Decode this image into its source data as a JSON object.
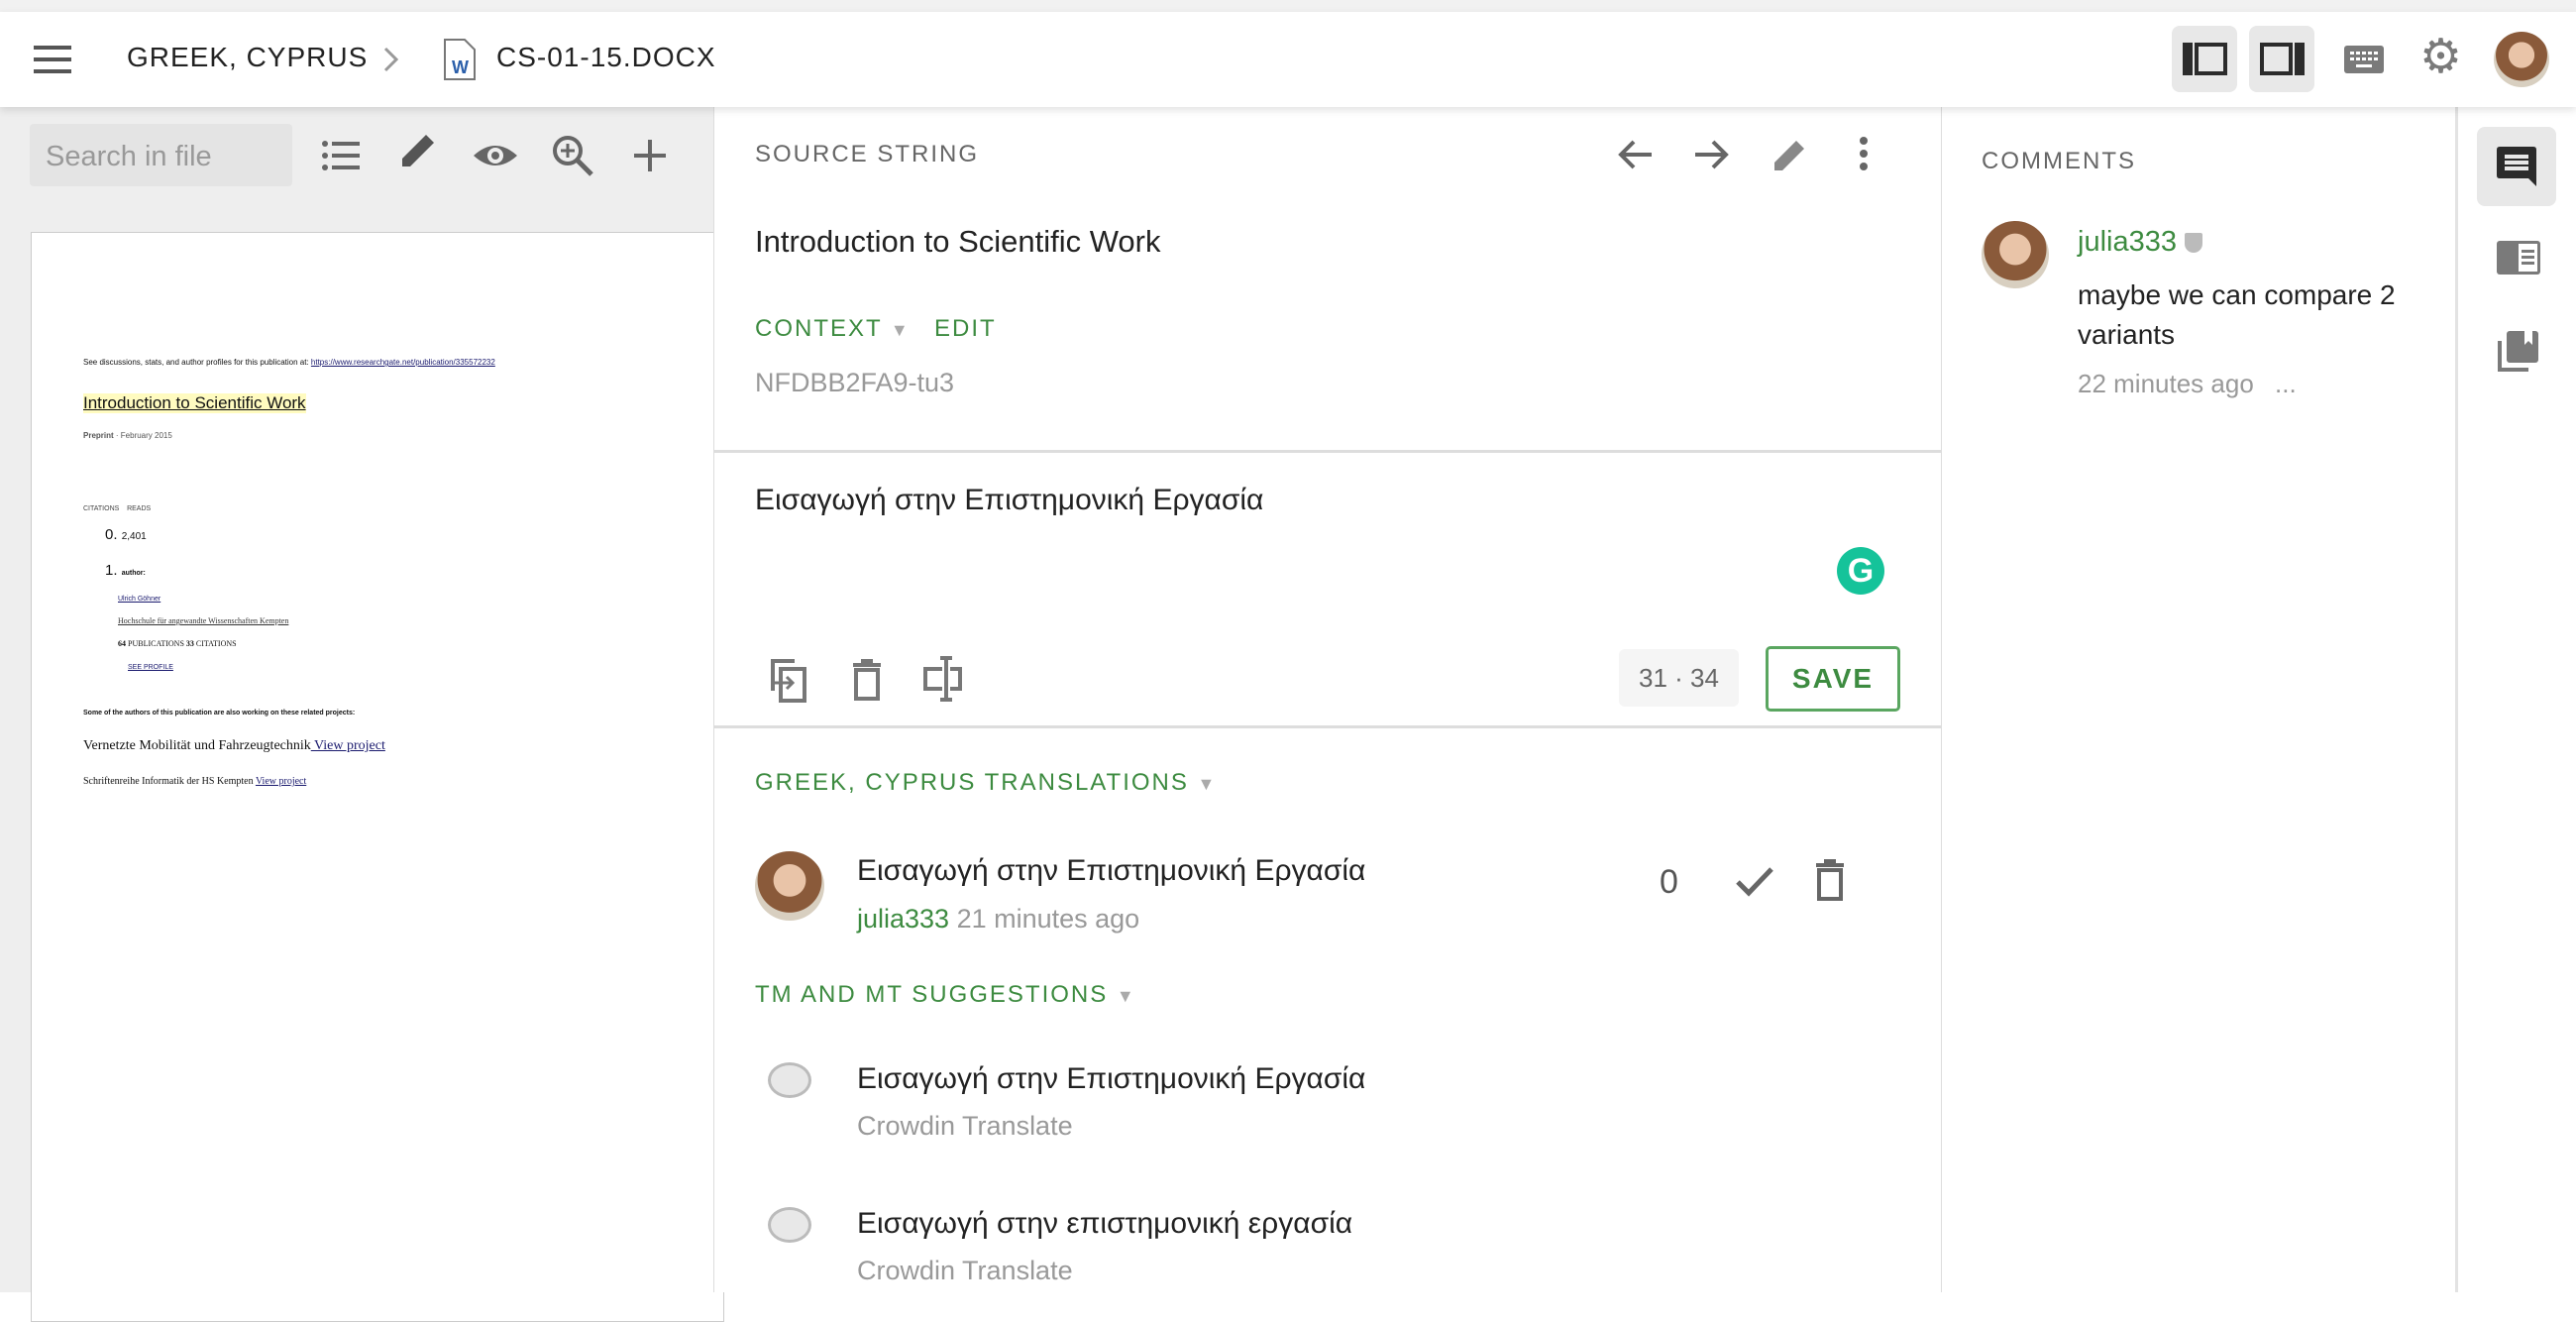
{
  "header": {
    "language": "GREEK, CYPRUS",
    "file_name": "CS-01-15.DOCX",
    "icons": [
      "menu-icon",
      "chevron-right-icon",
      "word-file-icon",
      "left-panel-layout-icon",
      "right-panel-layout-icon",
      "keyboard-icon",
      "gear-icon",
      "avatar"
    ]
  },
  "left_panel": {
    "search_placeholder": "Search in file",
    "tools": [
      "list-icon",
      "pencil-icon",
      "eye-icon",
      "zoom-in-icon",
      "plus-icon"
    ],
    "document": {
      "line1": "See discussions, stats, and author profiles for this publication at: ",
      "line1_link": "https://www.researchgate.net/publication/335572232",
      "title": "Introduction to Scientific Work",
      "preprint_bold": "Preprint",
      "preprint_rest": " · February 2015",
      "citations": "CITATIONS",
      "reads": "READS",
      "item0_num": "0.",
      "item0": "2,401",
      "item1_num": "1.",
      "item1": "author:",
      "author": "Ulrich Göhner",
      "affiliation": "Hochschule für angewandte Wissenschaften Kempten",
      "pubs_num": "64",
      "pubs": " PUBLICATIONS ",
      "cites_num": "33",
      "cites": " CITATIONS",
      "see_profile": "SEE PROFILE",
      "related": "Some of the authors of this publication are also working on these related projects:",
      "project1": "Vernetzte Mobilität und Fahrzeugtechnik",
      "project1_link": " View project",
      "project2": "Schriftenreihe Informatik der HS Kempten ",
      "project2_link": "View project"
    }
  },
  "source": {
    "label": "SOURCE STRING",
    "text": "Introduction to Scientific Work",
    "context_label": "CONTEXT",
    "edit_label": "EDIT",
    "key": "NFDBB2FA9-tu3"
  },
  "editor": {
    "translation": "Εισαγωγή στην Επιστημονική Εργασία",
    "count_current": "31",
    "count_source": "34",
    "save_label": "SAVE"
  },
  "translations": {
    "label": "GREEK, CYPRUS TRANSLATIONS",
    "items": [
      {
        "text": "Εισαγωγή στην Επιστημονική Εργασία",
        "user": "julia333",
        "time": " 21 minutes ago",
        "votes": "0"
      }
    ]
  },
  "suggestions": {
    "label": "TM AND MT SUGGESTIONS",
    "items": [
      {
        "text": "Εισαγωγή στην Επιστημονική Εργασία",
        "source": "Crowdin Translate"
      },
      {
        "text": "Εισαγωγή στην επιστημονική εργασία",
        "source": "Crowdin Translate"
      }
    ]
  },
  "comments": {
    "label": "COMMENTS",
    "items": [
      {
        "user": "julia333",
        "text_line1": "maybe we can compare 2",
        "text_line2": "variants",
        "time": "22 minutes ago",
        "more": "..."
      }
    ]
  },
  "colors": {
    "accent": "#3d8b40",
    "grammarly": "#15c39a"
  }
}
